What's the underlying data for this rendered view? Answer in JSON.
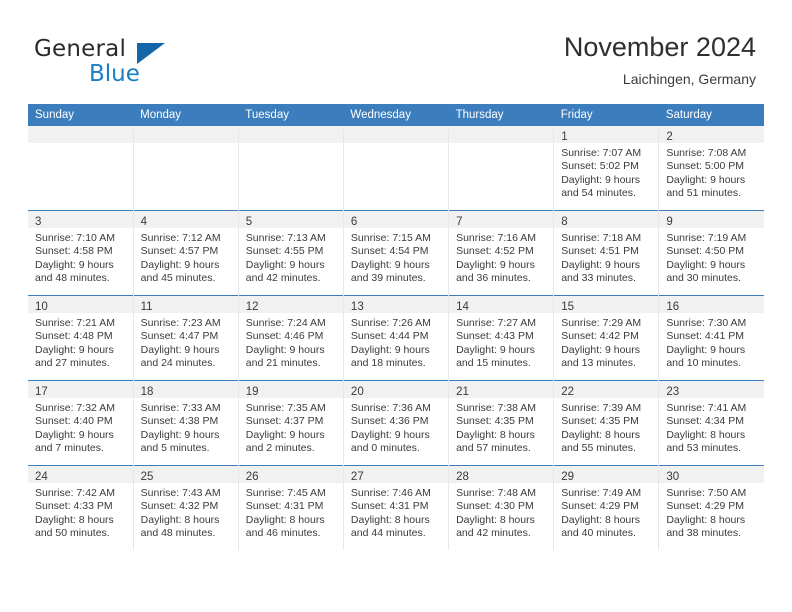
{
  "brand": {
    "name_top": "General",
    "name_bottom": "Blue",
    "triangle_color": "#1566a8",
    "blue_color": "#1b7fc4"
  },
  "header": {
    "title": "November 2024",
    "subtitle": "Laichingen, Germany"
  },
  "theme": {
    "header_blue": "#3c7ebd",
    "daynum_band": "#f1f1f1",
    "text": "#3b3b3b"
  },
  "weekday_headers": [
    "Sunday",
    "Monday",
    "Tuesday",
    "Wednesday",
    "Thursday",
    "Friday",
    "Saturday"
  ],
  "labels": {
    "sunrise_prefix": "Sunrise:",
    "sunset_prefix": "Sunset:",
    "daylight_prefix": "Daylight:"
  },
  "weeks": [
    [
      {
        "day": "",
        "lines": []
      },
      {
        "day": "",
        "lines": []
      },
      {
        "day": "",
        "lines": []
      },
      {
        "day": "",
        "lines": []
      },
      {
        "day": "",
        "lines": []
      },
      {
        "day": "1",
        "lines": [
          "Sunrise: 7:07 AM",
          "Sunset: 5:02 PM",
          "Daylight: 9 hours",
          "and 54 minutes."
        ]
      },
      {
        "day": "2",
        "lines": [
          "Sunrise: 7:08 AM",
          "Sunset: 5:00 PM",
          "Daylight: 9 hours",
          "and 51 minutes."
        ]
      }
    ],
    [
      {
        "day": "3",
        "lines": [
          "Sunrise: 7:10 AM",
          "Sunset: 4:58 PM",
          "Daylight: 9 hours",
          "and 48 minutes."
        ]
      },
      {
        "day": "4",
        "lines": [
          "Sunrise: 7:12 AM",
          "Sunset: 4:57 PM",
          "Daylight: 9 hours",
          "and 45 minutes."
        ]
      },
      {
        "day": "5",
        "lines": [
          "Sunrise: 7:13 AM",
          "Sunset: 4:55 PM",
          "Daylight: 9 hours",
          "and 42 minutes."
        ]
      },
      {
        "day": "6",
        "lines": [
          "Sunrise: 7:15 AM",
          "Sunset: 4:54 PM",
          "Daylight: 9 hours",
          "and 39 minutes."
        ]
      },
      {
        "day": "7",
        "lines": [
          "Sunrise: 7:16 AM",
          "Sunset: 4:52 PM",
          "Daylight: 9 hours",
          "and 36 minutes."
        ]
      },
      {
        "day": "8",
        "lines": [
          "Sunrise: 7:18 AM",
          "Sunset: 4:51 PM",
          "Daylight: 9 hours",
          "and 33 minutes."
        ]
      },
      {
        "day": "9",
        "lines": [
          "Sunrise: 7:19 AM",
          "Sunset: 4:50 PM",
          "Daylight: 9 hours",
          "and 30 minutes."
        ]
      }
    ],
    [
      {
        "day": "10",
        "lines": [
          "Sunrise: 7:21 AM",
          "Sunset: 4:48 PM",
          "Daylight: 9 hours",
          "and 27 minutes."
        ]
      },
      {
        "day": "11",
        "lines": [
          "Sunrise: 7:23 AM",
          "Sunset: 4:47 PM",
          "Daylight: 9 hours",
          "and 24 minutes."
        ]
      },
      {
        "day": "12",
        "lines": [
          "Sunrise: 7:24 AM",
          "Sunset: 4:46 PM",
          "Daylight: 9 hours",
          "and 21 minutes."
        ]
      },
      {
        "day": "13",
        "lines": [
          "Sunrise: 7:26 AM",
          "Sunset: 4:44 PM",
          "Daylight: 9 hours",
          "and 18 minutes."
        ]
      },
      {
        "day": "14",
        "lines": [
          "Sunrise: 7:27 AM",
          "Sunset: 4:43 PM",
          "Daylight: 9 hours",
          "and 15 minutes."
        ]
      },
      {
        "day": "15",
        "lines": [
          "Sunrise: 7:29 AM",
          "Sunset: 4:42 PM",
          "Daylight: 9 hours",
          "and 13 minutes."
        ]
      },
      {
        "day": "16",
        "lines": [
          "Sunrise: 7:30 AM",
          "Sunset: 4:41 PM",
          "Daylight: 9 hours",
          "and 10 minutes."
        ]
      }
    ],
    [
      {
        "day": "17",
        "lines": [
          "Sunrise: 7:32 AM",
          "Sunset: 4:40 PM",
          "Daylight: 9 hours",
          "and 7 minutes."
        ]
      },
      {
        "day": "18",
        "lines": [
          "Sunrise: 7:33 AM",
          "Sunset: 4:38 PM",
          "Daylight: 9 hours",
          "and 5 minutes."
        ]
      },
      {
        "day": "19",
        "lines": [
          "Sunrise: 7:35 AM",
          "Sunset: 4:37 PM",
          "Daylight: 9 hours",
          "and 2 minutes."
        ]
      },
      {
        "day": "20",
        "lines": [
          "Sunrise: 7:36 AM",
          "Sunset: 4:36 PM",
          "Daylight: 9 hours",
          "and 0 minutes."
        ]
      },
      {
        "day": "21",
        "lines": [
          "Sunrise: 7:38 AM",
          "Sunset: 4:35 PM",
          "Daylight: 8 hours",
          "and 57 minutes."
        ]
      },
      {
        "day": "22",
        "lines": [
          "Sunrise: 7:39 AM",
          "Sunset: 4:35 PM",
          "Daylight: 8 hours",
          "and 55 minutes."
        ]
      },
      {
        "day": "23",
        "lines": [
          "Sunrise: 7:41 AM",
          "Sunset: 4:34 PM",
          "Daylight: 8 hours",
          "and 53 minutes."
        ]
      }
    ],
    [
      {
        "day": "24",
        "lines": [
          "Sunrise: 7:42 AM",
          "Sunset: 4:33 PM",
          "Daylight: 8 hours",
          "and 50 minutes."
        ]
      },
      {
        "day": "25",
        "lines": [
          "Sunrise: 7:43 AM",
          "Sunset: 4:32 PM",
          "Daylight: 8 hours",
          "and 48 minutes."
        ]
      },
      {
        "day": "26",
        "lines": [
          "Sunrise: 7:45 AM",
          "Sunset: 4:31 PM",
          "Daylight: 8 hours",
          "and 46 minutes."
        ]
      },
      {
        "day": "27",
        "lines": [
          "Sunrise: 7:46 AM",
          "Sunset: 4:31 PM",
          "Daylight: 8 hours",
          "and 44 minutes."
        ]
      },
      {
        "day": "28",
        "lines": [
          "Sunrise: 7:48 AM",
          "Sunset: 4:30 PM",
          "Daylight: 8 hours",
          "and 42 minutes."
        ]
      },
      {
        "day": "29",
        "lines": [
          "Sunrise: 7:49 AM",
          "Sunset: 4:29 PM",
          "Daylight: 8 hours",
          "and 40 minutes."
        ]
      },
      {
        "day": "30",
        "lines": [
          "Sunrise: 7:50 AM",
          "Sunset: 4:29 PM",
          "Daylight: 8 hours",
          "and 38 minutes."
        ]
      }
    ]
  ]
}
